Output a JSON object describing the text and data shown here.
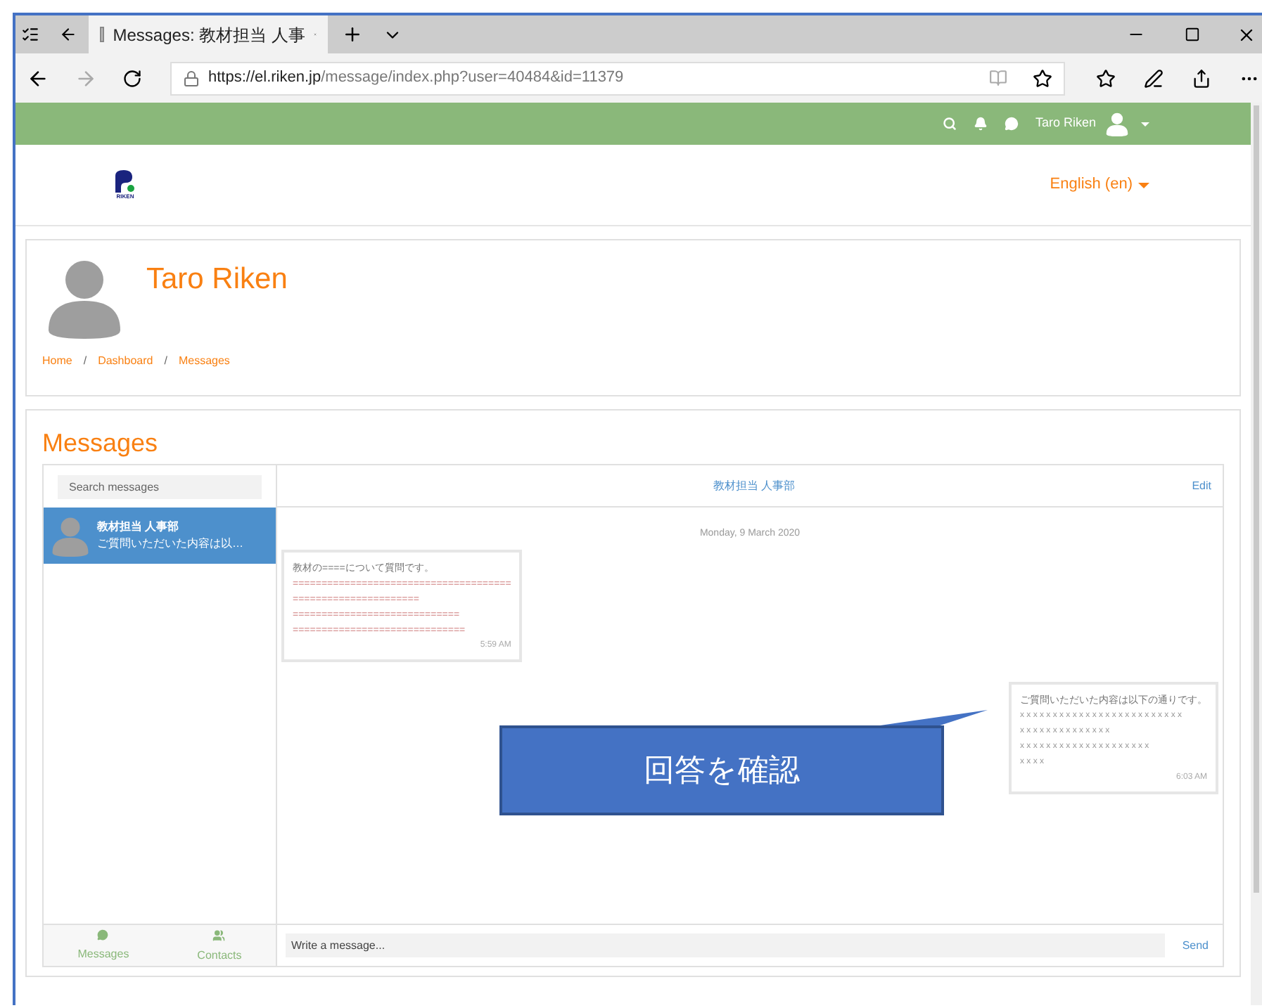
{
  "browser": {
    "tab_title": "Messages: 教材担当 人事",
    "url_host": "https://el.riken.jp",
    "url_path": "/message/index.php?user=40484&id=11379"
  },
  "navbar": {
    "user_name": "Taro Riken"
  },
  "header": {
    "logo_text": "RIKEN",
    "language": "English (en)"
  },
  "profile": {
    "name": "Taro Riken",
    "breadcrumb": [
      "Home",
      "Dashboard",
      "Messages"
    ],
    "separator": "/"
  },
  "messages": {
    "title": "Messages",
    "search": {
      "placeholder": "Search messages"
    },
    "conversations": [
      {
        "name": "教材担当 人事部",
        "preview": "ご質問いただいた内容は以…",
        "selected": true
      }
    ],
    "thread": {
      "title": "教材担当 人事部",
      "edit": "Edit",
      "date": "Monday, 9 March 2020",
      "items": [
        {
          "kind": "incoming",
          "lines": [
            "教材の====について質問です。",
            "======================================",
            "======================",
            "=============================",
            "=============================="
          ],
          "time": "5:59 AM"
        },
        {
          "kind": "outgoing",
          "lines": [
            "ご質問いただいた内容は以下の通りです。",
            "x x x x x x x x x x x x x x x x x x x x x x x x x",
            "x x x x x x x x x x x x x x",
            "x x x x x x x x x x x x x x x x x x x x",
            "x x x x"
          ],
          "time": "6:03 AM"
        }
      ]
    },
    "composer": {
      "placeholder": "Write a message...",
      "send": "Send"
    },
    "footer_tabs": [
      {
        "label": "Messages",
        "kind": "messages"
      },
      {
        "label": "Contacts",
        "kind": "contacts"
      }
    ]
  },
  "callout": {
    "text": "回答を確認"
  }
}
